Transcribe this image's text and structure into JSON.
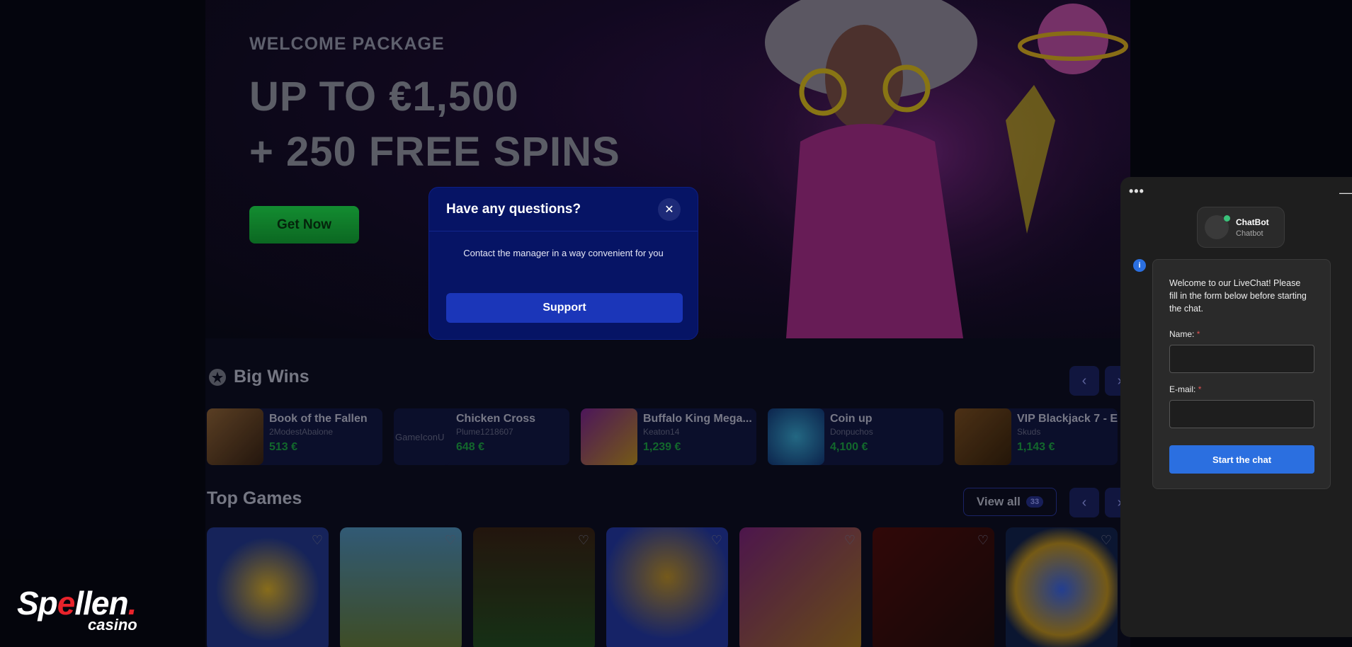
{
  "hero": {
    "eyebrow": "WELCOME PACKAGE",
    "title_line1": "UP TO €1,500",
    "title_line2": "+ 250 FREE SPINS",
    "cta": "Get Now"
  },
  "big_wins": {
    "title": "Big Wins",
    "items": [
      {
        "game": "Book of the Fallen",
        "user": "2ModestAbalone",
        "amount": "513 €"
      },
      {
        "game": "Chicken Cross",
        "user": "Plume1218607",
        "amount": "648 €",
        "broken_image_alt": "GameIconU"
      },
      {
        "game": "Buffalo King Mega...",
        "user": "Keaton14",
        "amount": "1,239 €"
      },
      {
        "game": "Coin up",
        "user": "Donpuchos",
        "amount": "4,100 €"
      },
      {
        "game": "VIP Blackjack 7 - E...",
        "user": "Skuds",
        "amount": "1,143 €"
      }
    ]
  },
  "top_games": {
    "title": "Top Games",
    "view_all": "View all",
    "count": "33"
  },
  "modal": {
    "title": "Have any questions?",
    "text": "Contact the manager in a way convenient for you",
    "button": "Support"
  },
  "chat": {
    "dots": "•••",
    "bot_name": "ChatBot",
    "bot_sub": "Chatbot",
    "welcome": "Welcome to our LiveChat! Please fill in the form below before starting the chat.",
    "name_label": "Name:",
    "email_label": "E-mail:",
    "required_mark": "*",
    "start_button": "Start the chat"
  },
  "logo": {
    "main_pre": "Sp",
    "main_accent": "e",
    "main_post": "llen",
    "dot": ".",
    "sub": "casino"
  },
  "colors": {
    "modal_bg": "#061465",
    "support_button": "#1b36b9",
    "chat_button": "#2b6fe0",
    "win_amount": "#167a34",
    "hero_cta": "#17a63a"
  }
}
